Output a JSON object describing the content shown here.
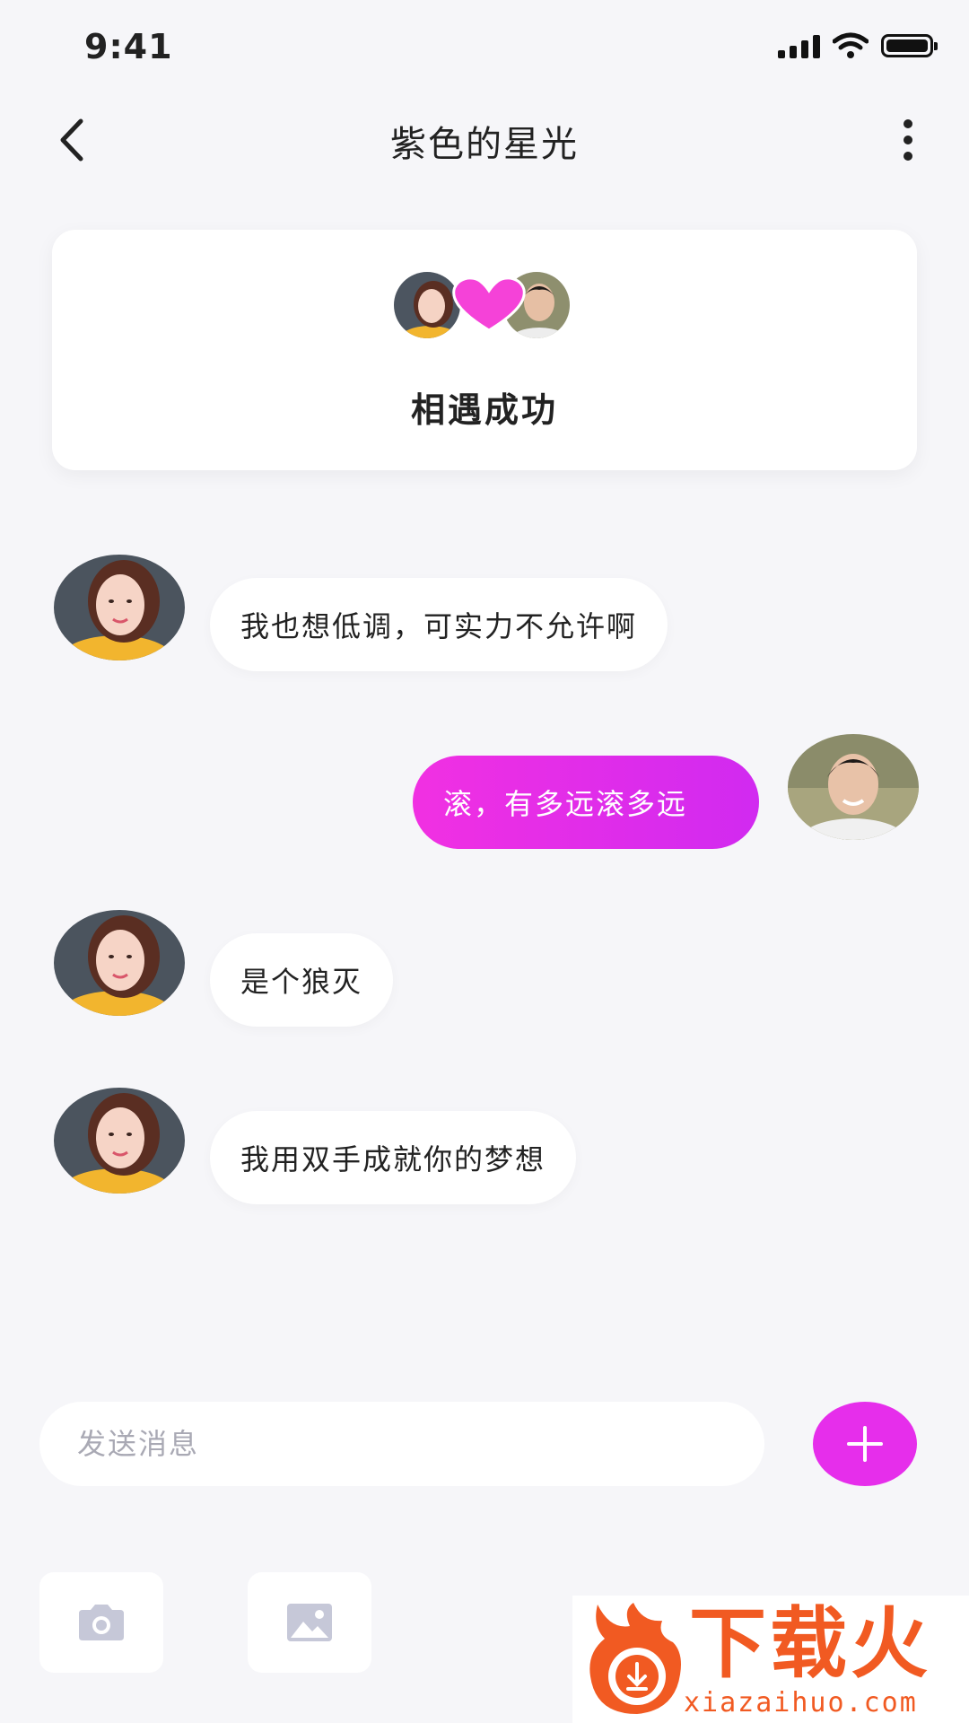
{
  "status_bar": {
    "time": "9:41"
  },
  "header": {
    "title": "紫色的星光"
  },
  "match_card": {
    "text": "相遇成功"
  },
  "messages": [
    {
      "side": "in",
      "text": "我也想低调，可实力不允许啊"
    },
    {
      "side": "out",
      "text": "滚，有多远滚多远"
    },
    {
      "side": "in",
      "text": "是个狼灭"
    },
    {
      "side": "in",
      "text": "我用双手成就你的梦想"
    }
  ],
  "composer": {
    "placeholder": "发送消息"
  },
  "toolbar": {
    "icons": [
      "camera-icon",
      "image-icon"
    ]
  },
  "watermark": {
    "title": "下载火",
    "url": "xiazaihuo.com"
  },
  "colors": {
    "accent": "#E62EEB",
    "background": "#F6F6F9",
    "watermark": "#F15A22"
  }
}
